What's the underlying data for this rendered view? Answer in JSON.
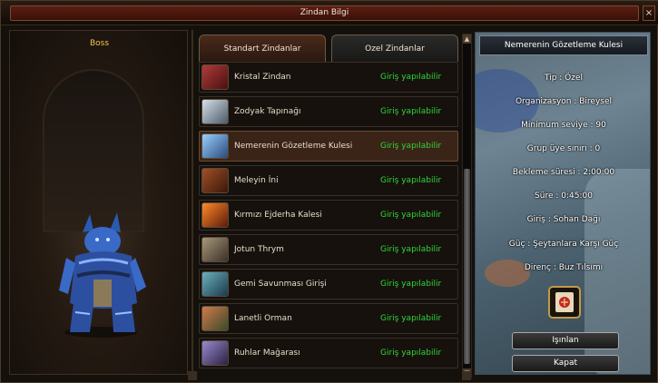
{
  "window": {
    "title": "Zindan Bilgi",
    "close_label": "×"
  },
  "boss": {
    "title": "Boss"
  },
  "tabs": [
    {
      "label": "Standart Zindanlar",
      "active": true
    },
    {
      "label": "Ozel Zindanlar",
      "active": false
    }
  ],
  "dungeons": [
    {
      "name": "Kristal Zindan",
      "status": "Giriş yapılabilir",
      "icon": "crystal-dungeon-icon",
      "icon_color": "#8a2a2a",
      "selected": false
    },
    {
      "name": "Zodyak Tapınağı",
      "status": "Giriş yapılabilir",
      "icon": "zodiac-temple-icon",
      "icon_color": "#6a7a8a",
      "selected": false
    },
    {
      "name": "Nemerenin Gözetleme Kulesi",
      "status": "Giriş yapılabilir",
      "icon": "nemere-tower-icon",
      "icon_color": "#4a7a9a",
      "selected": true
    },
    {
      "name": "Meleyin İni",
      "status": "Giriş yapılabilir",
      "icon": "meley-lair-icon",
      "icon_color": "#7a3a1a",
      "selected": false
    },
    {
      "name": "Kırmızı Ejderha Kalesi",
      "status": "Giriş yapılabilir",
      "icon": "red-dragon-fortress-icon",
      "icon_color": "#b04a1a",
      "selected": false
    },
    {
      "name": "Jotun Thrym",
      "status": "Giriş yapılabilir",
      "icon": "jotun-thrym-icon",
      "icon_color": "#6a5a4a",
      "selected": false
    },
    {
      "name": "Gemi Savunması Girişi",
      "status": "Giriş yapılabilir",
      "icon": "ship-defense-icon",
      "icon_color": "#3a6a7a",
      "selected": false
    },
    {
      "name": "Lanetli Orman",
      "status": "Giriş yapılabilir",
      "icon": "cursed-forest-icon",
      "icon_color": "#8a5a3a",
      "selected": false
    },
    {
      "name": "Ruhlar Mağarası",
      "status": "Giriş yapılabilir",
      "icon": "spirit-cave-icon",
      "icon_color": "#5a4a7a",
      "selected": false
    }
  ],
  "info": {
    "header": "Nemerenin Gözetleme Kulesi",
    "lines": [
      "Tip : Özel",
      "Organizasyon : Bireysel",
      "Minimum seviye : 90",
      "Grup üye sınırı : 0",
      "Bekleme süresi : 2:00:00",
      "Süre : 0:45:00",
      "Giriş : Sohan Dağı",
      "Güç : Şeytanlara Karşı Güç",
      "Direnç : Buz Tılsımı"
    ],
    "teleport_label": "Işınlan",
    "close_label": "Kapat"
  },
  "colors": {
    "status_green": "#2fd63a",
    "boss_title": "#f2c94c"
  }
}
